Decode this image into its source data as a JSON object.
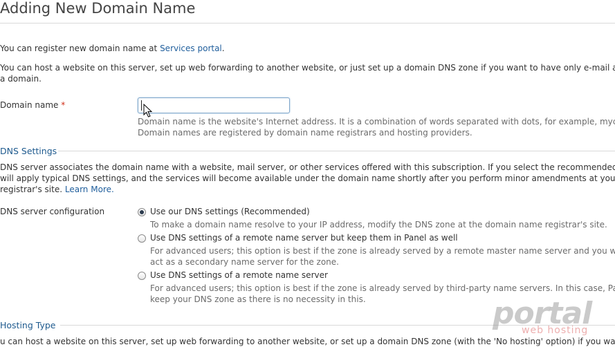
{
  "page": {
    "title": "Adding New Domain Name"
  },
  "intro": {
    "register_prefix": "You can register new domain name at ",
    "register_link": "Services portal",
    "register_suffix": ".",
    "host_line1": "You can host a website on this server, set up web forwarding to another website, or just set up a domain DNS zone if you want to have only e-mail addr",
    "host_line2": "a domain."
  },
  "domain": {
    "label": "Domain name",
    "required_mark": "*",
    "value": "",
    "placeholder": "",
    "hint_line1": "Domain name is the website's Internet address. It is a combination of words separated with dots, for example, mycor",
    "hint_line2": "Domain names are registered by domain name registrars and hosting providers."
  },
  "dns": {
    "section_title": "DNS Settings",
    "desc_line1": "DNS server associates the domain name with a website, mail server, or other services offered with this subscription. If you select the recommended op",
    "desc_line2": "will apply typical DNS settings, and the services will become available under the domain name shortly after you perform minor amendments at your dom",
    "desc_line3": "registrar's site. ",
    "learn_more": "Learn More.",
    "config_label": "DNS server configuration",
    "options": [
      {
        "label": "Use our DNS settings (Recommended)",
        "selected": true,
        "desc_line1": "To make a domain name resolve to your IP address, modify the DNS zone at the domain name registrar's site.",
        "desc_line2": ""
      },
      {
        "label": "Use DNS settings of a remote name server but keep them in Panel as well",
        "selected": false,
        "desc_line1": "For advanced users; this option is best if the zone is already served by a remote master name server and you wan",
        "desc_line2": "act as a secondary name server for the zone."
      },
      {
        "label": "Use DNS settings of a remote name server",
        "selected": false,
        "desc_line1": "For advanced users; this option is best if the zone is already served by third-party name servers. In this case, Pan",
        "desc_line2": "keep your DNS zone as there is no necessity in this."
      }
    ]
  },
  "hosting": {
    "section_title": "Hosting Type",
    "desc_line1": "u can host a website on this server, set up web forwarding to another website, or set up a domain DNS zone (with the 'No hosting' option) if you want"
  },
  "watermark": {
    "main": "portal",
    "sub": "web hosting"
  },
  "colors": {
    "link": "#1f5e9c",
    "section_title": "#1e5a8e",
    "required": "#d12f19"
  }
}
